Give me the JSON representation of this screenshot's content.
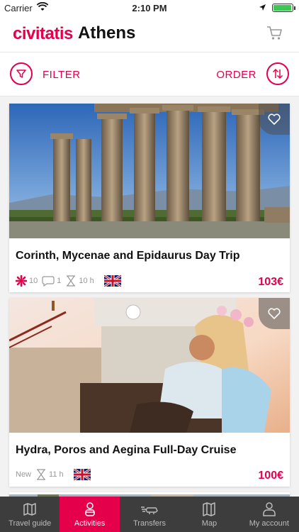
{
  "status": {
    "carrier": "Carrier",
    "time": "2:10 PM",
    "battery_level": 0.95
  },
  "header": {
    "logo": "civitatis",
    "city": "Athens"
  },
  "toolbar": {
    "filter_label": "FILTER",
    "order_label": "ORDER"
  },
  "activities": [
    {
      "title": "Corinth, Mycenae and Epidaurus Day Trip",
      "rating": "10",
      "reviews": "1",
      "duration": "10 h",
      "language": "english",
      "price": "103€"
    },
    {
      "title": "Hydra, Poros and Aegina Full-Day Cruise",
      "badge": "New",
      "duration": "11 h",
      "language": "english",
      "price": "100€"
    }
  ],
  "tabs": [
    {
      "label": "Travel guide",
      "icon": "map-book-icon"
    },
    {
      "label": "Activities",
      "icon": "person-icon"
    },
    {
      "label": "Transfers",
      "icon": "transfer-icon"
    },
    {
      "label": "Map",
      "icon": "map-icon"
    },
    {
      "label": "My account",
      "icon": "account-icon"
    }
  ],
  "colors": {
    "accent": "#e4004a",
    "tabbar": "#3d3d3d"
  }
}
